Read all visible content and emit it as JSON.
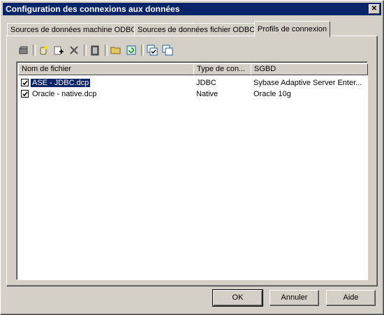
{
  "window": {
    "title": "Configuration des connexions aux données",
    "close_label": "✕"
  },
  "tabs": [
    {
      "label": "Sources de données machine ODBC"
    },
    {
      "label": "Sources de données fichier ODBC"
    },
    {
      "label": "Profils de connexion",
      "active": true
    }
  ],
  "toolbar": {
    "icons": [
      "properties-icon",
      "new-profile-icon",
      "add-profile-icon",
      "delete-icon",
      "clipboard-icon",
      "open-folder-icon",
      "refresh-icon",
      "check-all-icon",
      "uncheck-all-icon"
    ]
  },
  "list": {
    "columns": [
      "Nom de fichier",
      "Type de con...",
      "SGBD"
    ],
    "rows": [
      {
        "name": "ASE - JDBC.dcp",
        "type": "JDBC",
        "dbms": "Sybase Adaptive Server Enter...",
        "checked": true,
        "selected": true
      },
      {
        "name": "Oracle - native.dcp",
        "type": "Native",
        "dbms": "Oracle 10g",
        "checked": true,
        "selected": false
      }
    ]
  },
  "buttons": {
    "ok": "OK",
    "cancel": "Annuler",
    "help": "Aide"
  }
}
